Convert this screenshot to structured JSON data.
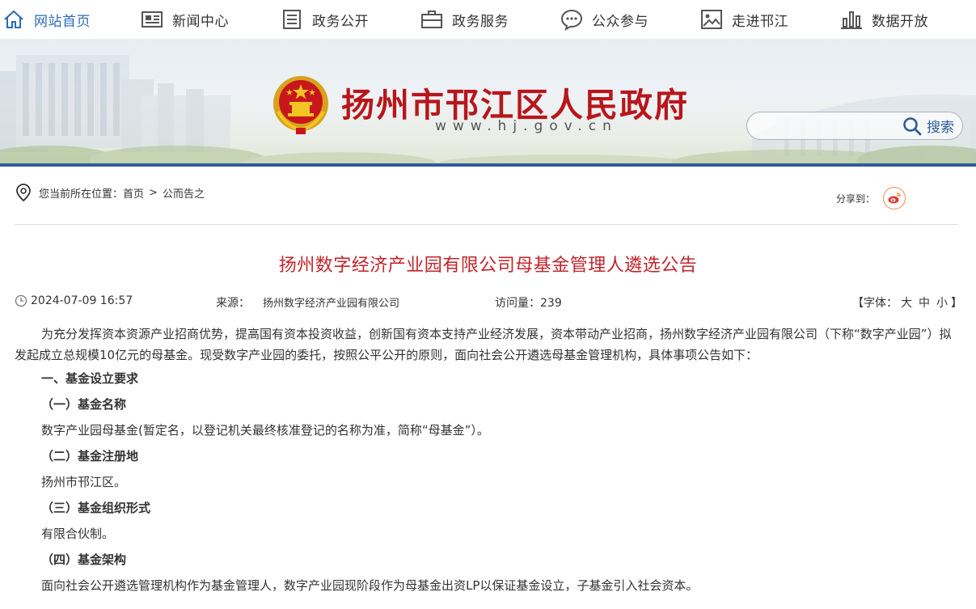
{
  "nav": [
    {
      "label": "网站首页",
      "icon": "home-icon"
    },
    {
      "label": "新闻中心",
      "icon": "newspaper-icon"
    },
    {
      "label": "政务公开",
      "icon": "document-list-icon"
    },
    {
      "label": "政务服务",
      "icon": "briefcase-icon"
    },
    {
      "label": "公众参与",
      "icon": "chat-bubble-icon"
    },
    {
      "label": "走进邗江",
      "icon": "picture-icon"
    },
    {
      "label": "数据开放",
      "icon": "bar-chart-icon"
    }
  ],
  "header": {
    "site_title": "扬州市邗江区人民政府",
    "site_url": "www.hj.gov.cn",
    "search_placeholder": "",
    "search_label": "搜索"
  },
  "breadcrumb": {
    "prefix": "您当前所在位置：",
    "items": [
      "首页",
      "公而告之"
    ],
    "separator": ">"
  },
  "share": {
    "label": "分享到：",
    "icon": "weibo-icon"
  },
  "article": {
    "title": "扬州数字经济产业园有限公司母基金管理人遴选公告",
    "date": "2024-07-09 16:57",
    "source_label": "来源：",
    "source": "扬州数字经济产业园有限公司",
    "visits_label": "访问量：",
    "visits": "239",
    "font_label": "【字体：",
    "font_large": "大",
    "font_medium": "中",
    "font_small": "小",
    "font_close": "】",
    "intro": "为充分发挥资本资源产业招商优势，提高国有资本投资收益，创新国有资本支持产业经济发展，资本带动产业招商，扬州数字经济产业园有限公司（下称“数字产业园”）拟发起成立总规模10亿元的母基金。现受数字产业园的委托，按照公平公开的原则，面向社会公开遴选母基金管理机构，具体事项公告如下：",
    "section1": "一、基金设立要求",
    "sub1": "（一）基金名称",
    "text1": "数字产业园母基金(暂定名，以登记机关最终核准登记的名称为准，简称“母基金”）。",
    "sub2": "（二）基金注册地",
    "text2": "扬州市邗江区。",
    "sub3": "（三）基金组织形式",
    "text3": "有限合伙制。",
    "sub4": "（四）基金架构",
    "text4": "面向社会公开遴选管理机构作为基金管理人，数字产业园现阶段作为母基金出资LP以保证基金设立，子基金引入社会资本。"
  },
  "colors": {
    "accent": "#2b6cb5",
    "title_red": "#c3232a",
    "banner_bar": "#2f5b9a"
  }
}
